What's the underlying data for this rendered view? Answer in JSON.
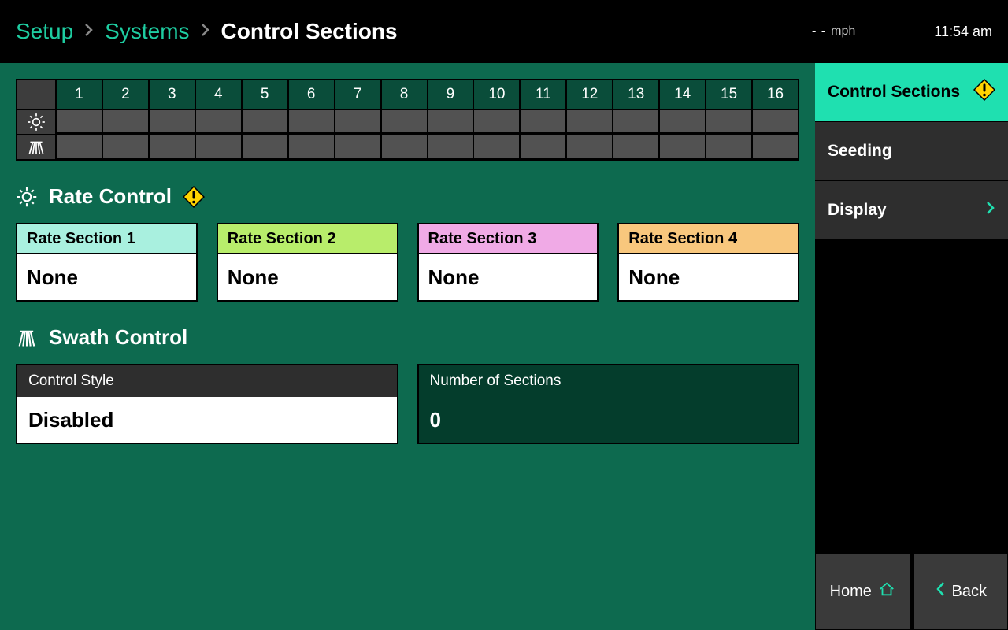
{
  "breadcrumb": {
    "setup": "Setup",
    "systems": "Systems",
    "current": "Control Sections"
  },
  "status": {
    "speed_val": "- -",
    "speed_unit": "mph",
    "time": "11:54 am"
  },
  "grid": {
    "columns": [
      "1",
      "2",
      "3",
      "4",
      "5",
      "6",
      "7",
      "8",
      "9",
      "10",
      "11",
      "12",
      "13",
      "14",
      "15",
      "16"
    ]
  },
  "rate_control": {
    "heading": "Rate Control",
    "sections": [
      {
        "label": "Rate Section 1",
        "value": "None",
        "color": "#a9f0df"
      },
      {
        "label": "Rate Section 2",
        "value": "None",
        "color": "#b8ed6b"
      },
      {
        "label": "Rate Section 3",
        "value": "None",
        "color": "#f0aae6"
      },
      {
        "label": "Rate Section 4",
        "value": "None",
        "color": "#f8c77d"
      }
    ]
  },
  "swath_control": {
    "heading": "Swath Control",
    "style_label": "Control Style",
    "style_value": "Disabled",
    "count_label": "Number of Sections",
    "count_value": "0"
  },
  "sidebar": {
    "items": [
      {
        "label": "Control Sections",
        "active": true,
        "warn": true
      },
      {
        "label": "Seeding"
      },
      {
        "label": "Display",
        "chevron": true
      }
    ]
  },
  "nav": {
    "home": "Home",
    "back": "Back"
  }
}
